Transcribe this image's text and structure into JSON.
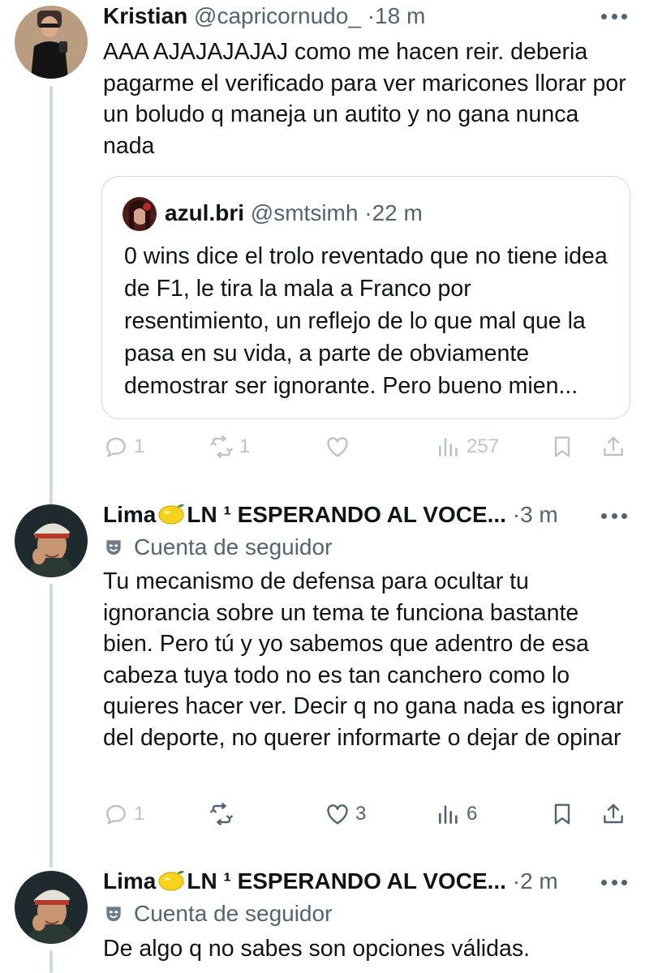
{
  "tweets": [
    {
      "name": "Kristian",
      "handle": "@capricornudo_",
      "separator": "·",
      "time": "18 m",
      "text": "AAA AJAJAJAJAJ como me hacen reir. deberia pagarme el verificado para ver maricones llorar por un boludo q maneja un autito y no gana nunca nada",
      "quote": {
        "name": "azul.bri",
        "handle": "@smtsimh",
        "separator": "·",
        "time": "22 m",
        "text": "0 wins dice el trolo reventado que no tiene idea de F1, le tira la mala a Franco por resentimiento, un reflejo de lo que mal que la pasa en su vida, a parte de obviamente demostrar ser ignorante. Pero bueno mien..."
      },
      "stats": {
        "replies": "1",
        "retweets": "1",
        "likes": "",
        "views": "257"
      }
    },
    {
      "name": "Lima",
      "name_suffix": "LN ¹ ESPERANDO AL VOCE...",
      "separator": "·",
      "time": "3 m",
      "badge": "Cuenta de seguidor",
      "text": "Tu mecanismo de defensa para ocultar tu ignorancia sobre un tema te funciona bastante bien. Pero tú y yo sabemos que adentro de esa cabeza tuya todo no es tan canchero como lo quieres hacer ver. Decir q no gana nada es ignorar del deporte, no querer informarte o dejar de opinar",
      "stats": {
        "replies": "1",
        "retweets": "",
        "likes": "3",
        "views": "6"
      }
    },
    {
      "name": "Lima",
      "name_suffix": "LN ¹ ESPERANDO AL VOCE...",
      "separator": "·",
      "time": "2 m",
      "badge": "Cuenta de seguidor",
      "text": "De algo q no sabes son opciones válidas."
    }
  ],
  "icons": {
    "reply": "reply-icon",
    "retweet": "retweet-icon",
    "like": "heart-icon",
    "views": "views-icon",
    "bookmark": "bookmark-icon",
    "share": "share-icon",
    "more": "more-icon",
    "badge": "mask-icon",
    "emoji": "lemon-emoji"
  },
  "colors": {
    "text": "#0f1419",
    "secondary": "#536471",
    "border": "#cfd9de"
  }
}
